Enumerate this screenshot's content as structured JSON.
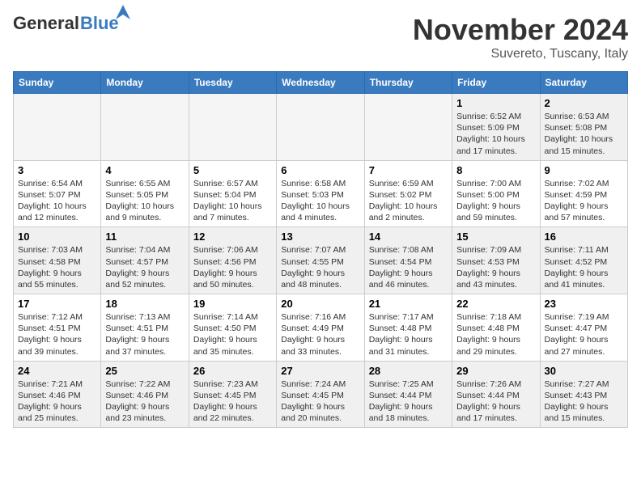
{
  "header": {
    "logo": {
      "general": "General",
      "blue": "Blue"
    },
    "title": "November 2024",
    "subtitle": "Suvereto, Tuscany, Italy"
  },
  "calendar": {
    "days_of_week": [
      "Sunday",
      "Monday",
      "Tuesday",
      "Wednesday",
      "Thursday",
      "Friday",
      "Saturday"
    ],
    "weeks": [
      [
        {
          "day": "",
          "info": "",
          "empty": true
        },
        {
          "day": "",
          "info": "",
          "empty": true
        },
        {
          "day": "",
          "info": "",
          "empty": true
        },
        {
          "day": "",
          "info": "",
          "empty": true
        },
        {
          "day": "",
          "info": "",
          "empty": true
        },
        {
          "day": "1",
          "info": "Sunrise: 6:52 AM\nSunset: 5:09 PM\nDaylight: 10 hours and 17 minutes."
        },
        {
          "day": "2",
          "info": "Sunrise: 6:53 AM\nSunset: 5:08 PM\nDaylight: 10 hours and 15 minutes."
        }
      ],
      [
        {
          "day": "3",
          "info": "Sunrise: 6:54 AM\nSunset: 5:07 PM\nDaylight: 10 hours and 12 minutes."
        },
        {
          "day": "4",
          "info": "Sunrise: 6:55 AM\nSunset: 5:05 PM\nDaylight: 10 hours and 9 minutes."
        },
        {
          "day": "5",
          "info": "Sunrise: 6:57 AM\nSunset: 5:04 PM\nDaylight: 10 hours and 7 minutes."
        },
        {
          "day": "6",
          "info": "Sunrise: 6:58 AM\nSunset: 5:03 PM\nDaylight: 10 hours and 4 minutes."
        },
        {
          "day": "7",
          "info": "Sunrise: 6:59 AM\nSunset: 5:02 PM\nDaylight: 10 hours and 2 minutes."
        },
        {
          "day": "8",
          "info": "Sunrise: 7:00 AM\nSunset: 5:00 PM\nDaylight: 9 hours and 59 minutes."
        },
        {
          "day": "9",
          "info": "Sunrise: 7:02 AM\nSunset: 4:59 PM\nDaylight: 9 hours and 57 minutes."
        }
      ],
      [
        {
          "day": "10",
          "info": "Sunrise: 7:03 AM\nSunset: 4:58 PM\nDaylight: 9 hours and 55 minutes."
        },
        {
          "day": "11",
          "info": "Sunrise: 7:04 AM\nSunset: 4:57 PM\nDaylight: 9 hours and 52 minutes."
        },
        {
          "day": "12",
          "info": "Sunrise: 7:06 AM\nSunset: 4:56 PM\nDaylight: 9 hours and 50 minutes."
        },
        {
          "day": "13",
          "info": "Sunrise: 7:07 AM\nSunset: 4:55 PM\nDaylight: 9 hours and 48 minutes."
        },
        {
          "day": "14",
          "info": "Sunrise: 7:08 AM\nSunset: 4:54 PM\nDaylight: 9 hours and 46 minutes."
        },
        {
          "day": "15",
          "info": "Sunrise: 7:09 AM\nSunset: 4:53 PM\nDaylight: 9 hours and 43 minutes."
        },
        {
          "day": "16",
          "info": "Sunrise: 7:11 AM\nSunset: 4:52 PM\nDaylight: 9 hours and 41 minutes."
        }
      ],
      [
        {
          "day": "17",
          "info": "Sunrise: 7:12 AM\nSunset: 4:51 PM\nDaylight: 9 hours and 39 minutes."
        },
        {
          "day": "18",
          "info": "Sunrise: 7:13 AM\nSunset: 4:51 PM\nDaylight: 9 hours and 37 minutes."
        },
        {
          "day": "19",
          "info": "Sunrise: 7:14 AM\nSunset: 4:50 PM\nDaylight: 9 hours and 35 minutes."
        },
        {
          "day": "20",
          "info": "Sunrise: 7:16 AM\nSunset: 4:49 PM\nDaylight: 9 hours and 33 minutes."
        },
        {
          "day": "21",
          "info": "Sunrise: 7:17 AM\nSunset: 4:48 PM\nDaylight: 9 hours and 31 minutes."
        },
        {
          "day": "22",
          "info": "Sunrise: 7:18 AM\nSunset: 4:48 PM\nDaylight: 9 hours and 29 minutes."
        },
        {
          "day": "23",
          "info": "Sunrise: 7:19 AM\nSunset: 4:47 PM\nDaylight: 9 hours and 27 minutes."
        }
      ],
      [
        {
          "day": "24",
          "info": "Sunrise: 7:21 AM\nSunset: 4:46 PM\nDaylight: 9 hours and 25 minutes."
        },
        {
          "day": "25",
          "info": "Sunrise: 7:22 AM\nSunset: 4:46 PM\nDaylight: 9 hours and 23 minutes."
        },
        {
          "day": "26",
          "info": "Sunrise: 7:23 AM\nSunset: 4:45 PM\nDaylight: 9 hours and 22 minutes."
        },
        {
          "day": "27",
          "info": "Sunrise: 7:24 AM\nSunset: 4:45 PM\nDaylight: 9 hours and 20 minutes."
        },
        {
          "day": "28",
          "info": "Sunrise: 7:25 AM\nSunset: 4:44 PM\nDaylight: 9 hours and 18 minutes."
        },
        {
          "day": "29",
          "info": "Sunrise: 7:26 AM\nSunset: 4:44 PM\nDaylight: 9 hours and 17 minutes."
        },
        {
          "day": "30",
          "info": "Sunrise: 7:27 AM\nSunset: 4:43 PM\nDaylight: 9 hours and 15 minutes."
        }
      ]
    ]
  }
}
